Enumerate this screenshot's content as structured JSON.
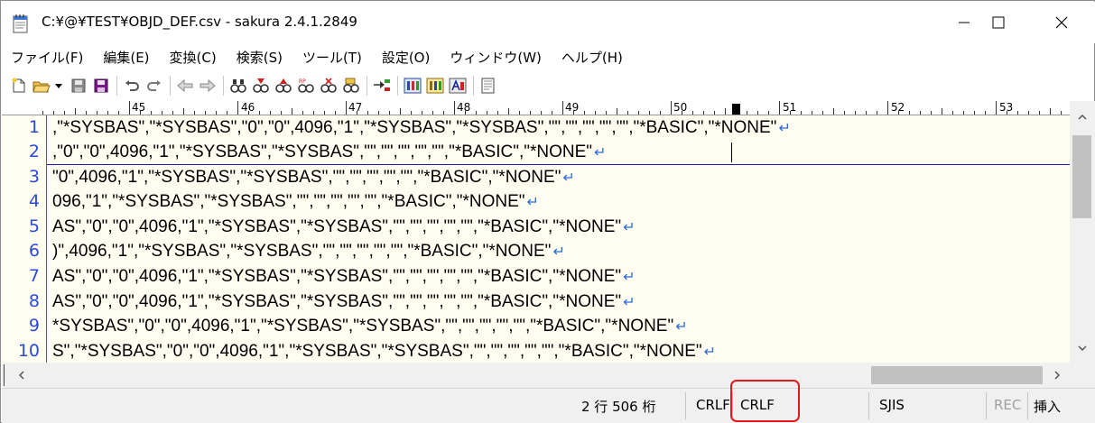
{
  "window": {
    "title": "C:¥@¥TEST¥OBJD_DEF.csv - sakura 2.4.1.2849"
  },
  "menu": [
    "ファイル(F)",
    "編集(E)",
    "変換(C)",
    "検索(S)",
    "ツール(T)",
    "設定(O)",
    "ウィンドウ(W)",
    "ヘルプ(H)"
  ],
  "toolbar": {
    "icons": [
      "new-file-icon",
      "open-folder-icon",
      "save-icon",
      "save-all-icon",
      "undo-icon",
      "redo-icon",
      "jump-back-icon",
      "jump-forward-icon",
      "search-icon",
      "search-down-icon",
      "search-up-icon",
      "replace-icon",
      "clear-mark-icon",
      "grep-icon",
      "tag-jump-icon",
      "settings-type-icon",
      "settings-common-icon",
      "font-icon",
      "print-preview-icon"
    ]
  },
  "ruler": {
    "labels": [
      "45",
      "46",
      "47",
      "48",
      "49",
      "50",
      "51",
      "52",
      "53"
    ]
  },
  "editor": {
    "lines": [
      {
        "num": "1",
        "text": ",\"*SYSBAS\",\"*SYSBAS\",\"0\",\"0\",4096,\"1\",\"*SYSBAS\",\"*SYSBAS\",\"\",\"\",\"\",\"\",\"\",\"*BASIC\",\"*NONE\""
      },
      {
        "num": "2",
        "text": ",\"0\",\"0\",4096,\"1\",\"*SYSBAS\",\"*SYSBAS\",\"\",\"\",\"\",\"\",\"\",\"*BASIC\",\"*NONE\""
      },
      {
        "num": "3",
        "text": "\"0\",4096,\"1\",\"*SYSBAS\",\"*SYSBAS\",\"\",\"\",\"\",\"\",\"\",\"*BASIC\",\"*NONE\""
      },
      {
        "num": "4",
        "text": "096,\"1\",\"*SYSBAS\",\"*SYSBAS\",\"\",\"\",\"\",\"\",\"\",\"*BASIC\",\"*NONE\""
      },
      {
        "num": "5",
        "text": "AS\",\"0\",\"0\",4096,\"1\",\"*SYSBAS\",\"*SYSBAS\",\"\",\"\",\"\",\"\",\"\",\"*BASIC\",\"*NONE\""
      },
      {
        "num": "6",
        "text": ")\",4096,\"1\",\"*SYSBAS\",\"*SYSBAS\",\"\",\"\",\"\",\"\",\"\",\"*BASIC\",\"*NONE\""
      },
      {
        "num": "7",
        "text": "AS\",\"0\",\"0\",4096,\"1\",\"*SYSBAS\",\"*SYSBAS\",\"\",\"\",\"\",\"\",\"\",\"*BASIC\",\"*NONE\""
      },
      {
        "num": "8",
        "text": "AS\",\"0\",\"0\",4096,\"1\",\"*SYSBAS\",\"*SYSBAS\",\"\",\"\",\"\",\"\",\"\",\"*BASIC\",\"*NONE\""
      },
      {
        "num": "9",
        "text": "*SYSBAS\",\"0\",\"0\",4096,\"1\",\"*SYSBAS\",\"*SYSBAS\",\"\",\"\",\"\",\"\",\"\",\"*BASIC\",\"*NONE\""
      },
      {
        "num": "10",
        "text": "S\",\"*SYSBAS\",\"0\",\"0\",4096,\"1\",\"*SYSBAS\",\"*SYSBAS\",\"\",\"\",\"\",\"\",\"\",\"*BASIC\",\"*NONE\""
      }
    ],
    "eol_mark": "↵"
  },
  "status": {
    "row_col": "2 行 506 桁",
    "eol_left": "CRLF",
    "eol_highlighted": "CRLF",
    "encoding": "SJIS",
    "rec": "REC",
    "mode": "挿入"
  },
  "colors": {
    "editor_bg": "#fffcf0",
    "line_number": "#2c4ad8",
    "eol_mark": "#2c6bd8",
    "highlight": "#e5191b"
  }
}
